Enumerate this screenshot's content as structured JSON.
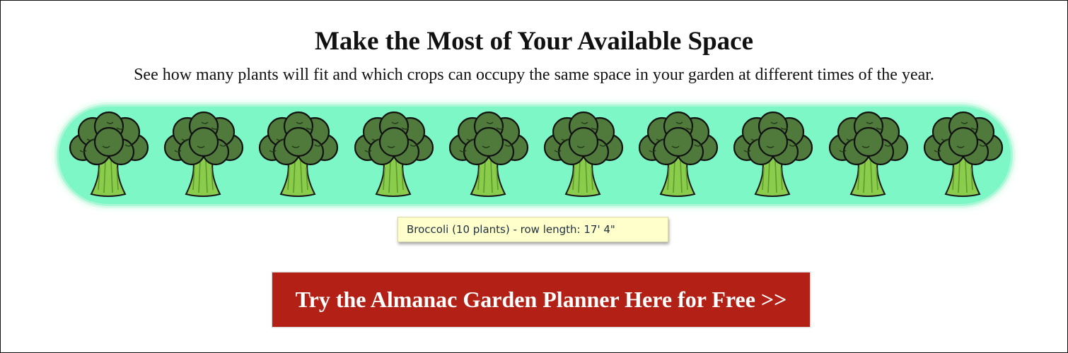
{
  "header": {
    "title": "Make the Most of Your Available Space",
    "subtitle": "See how many plants will fit and which crops can occupy the same space in your garden at different times of the year."
  },
  "garden_row": {
    "crop": "broccoli",
    "plant_count": 10,
    "plant_icon": "broccoli-icon",
    "bed_color": "#7df7c6"
  },
  "tooltip": {
    "text": "Broccoli (10 plants) - row length: 17' 4\""
  },
  "cta": {
    "label": "Try the Almanac Garden Planner Here for Free >>",
    "color": "#b32016"
  }
}
